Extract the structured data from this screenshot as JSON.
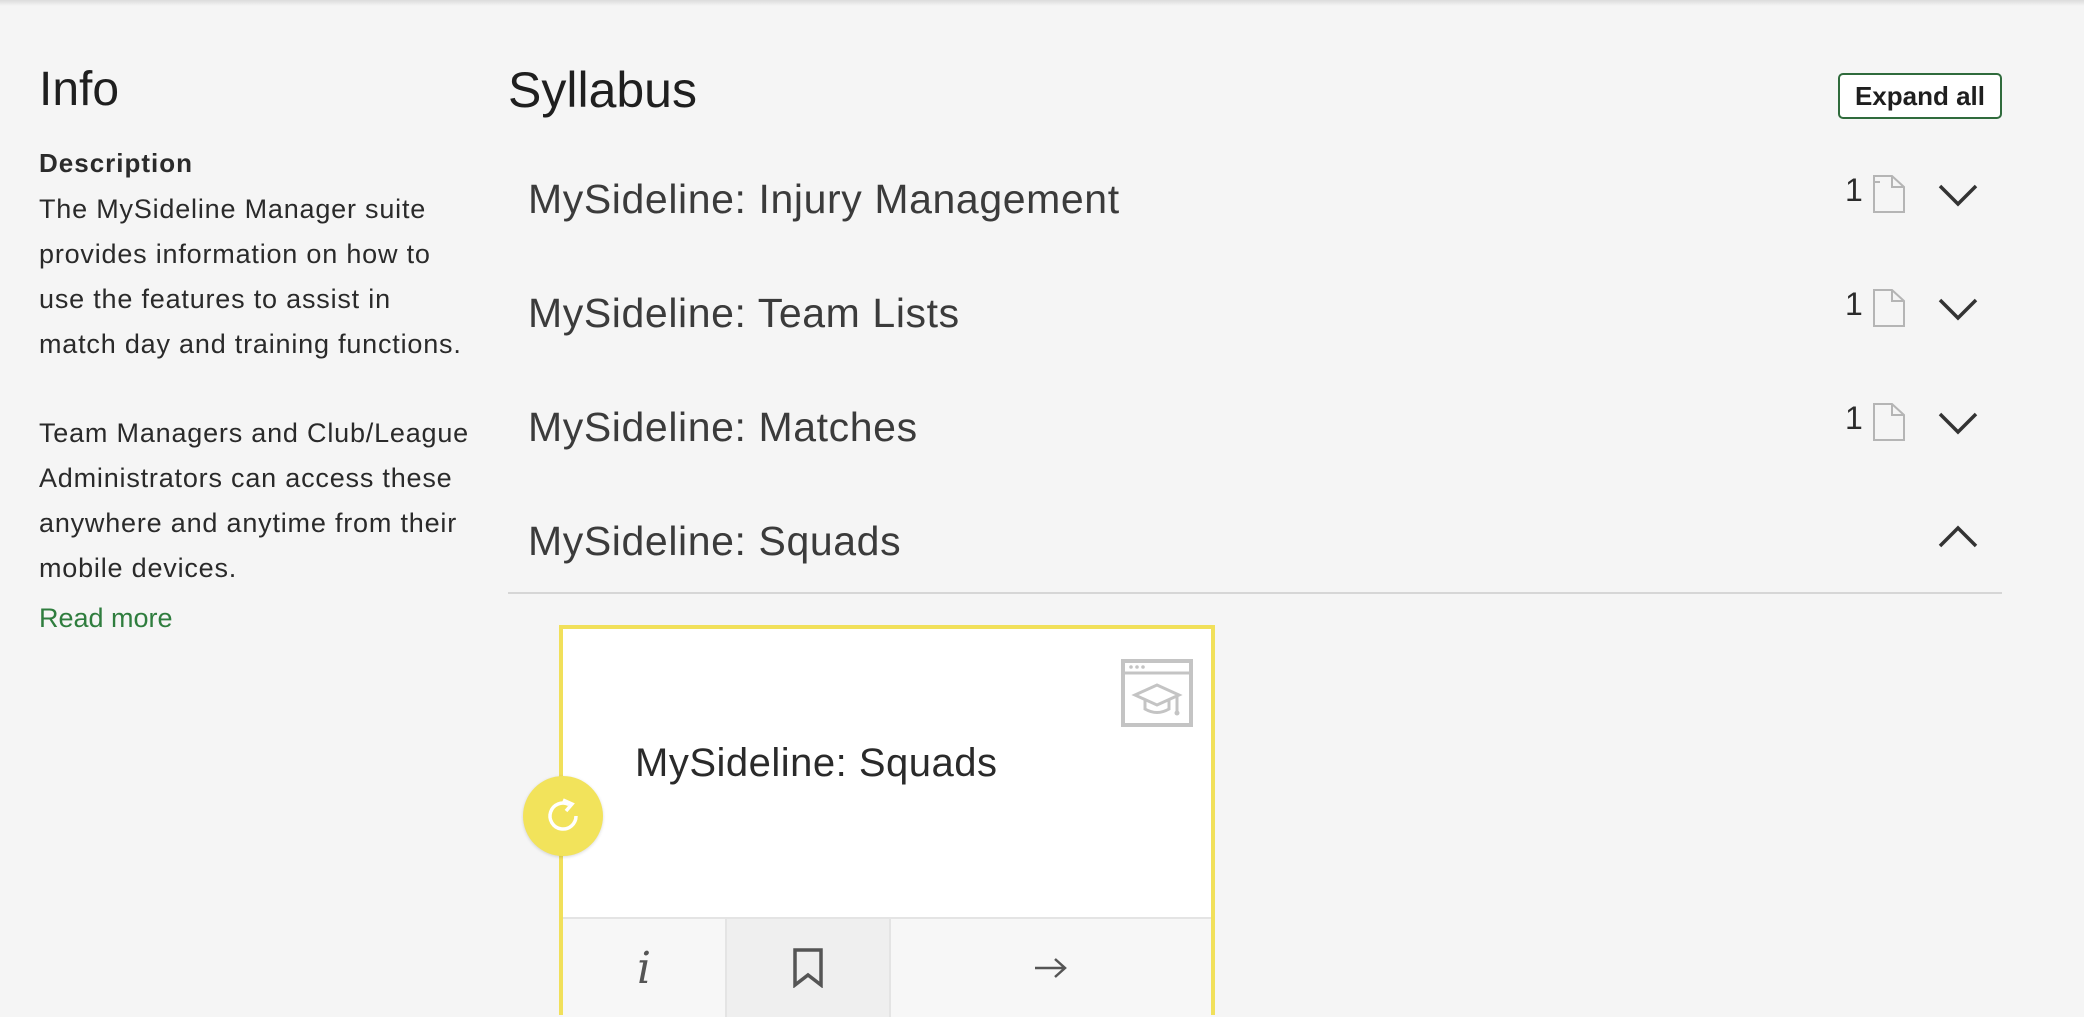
{
  "info": {
    "title": "Info",
    "description_heading": "Description",
    "paragraph1": "The MySideline Manager suite provides information on how to use the features to assist in match day and training functions.",
    "paragraph2": "Team Managers and Club/League Administrators can access these anywhere and anytime from their mobile devices.",
    "read_more": "Read more"
  },
  "syllabus": {
    "title": "Syllabus",
    "expand_all": "Expand all",
    "modules": [
      {
        "title": "MySideline: Injury Management",
        "count": "1",
        "expanded": false
      },
      {
        "title": "MySideline: Team Lists",
        "count": "1",
        "expanded": false
      },
      {
        "title": "MySideline: Matches",
        "count": "1",
        "expanded": false
      },
      {
        "title": "MySideline: Squads",
        "count": "",
        "expanded": true
      }
    ]
  },
  "card": {
    "title": "MySideline: Squads",
    "icon": "course-icon",
    "status_icon": "refresh-icon"
  },
  "colors": {
    "accent_green": "#2f7d3e",
    "card_highlight": "#f1e05a"
  }
}
